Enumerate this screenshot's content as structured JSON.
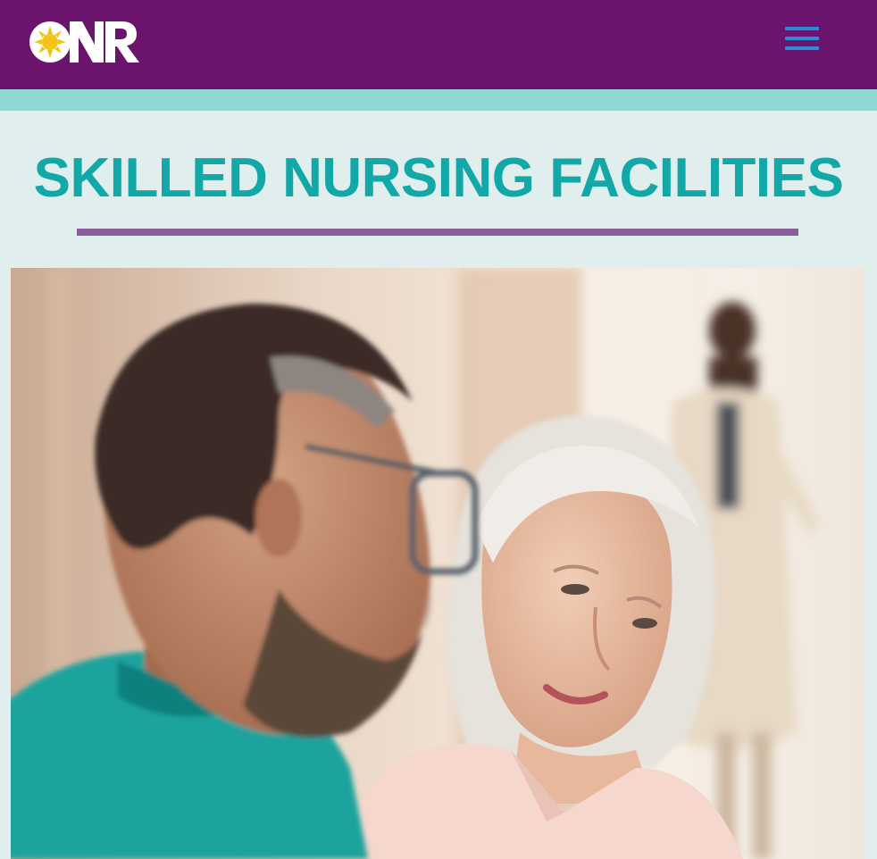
{
  "header": {
    "logo_text": "ONR",
    "menu_icon": "hamburger-menu-icon"
  },
  "page": {
    "title": "SKILLED NURSING FACILITIES"
  },
  "hero": {
    "image_subject": "nurse-with-senior-resident-photo"
  },
  "colors": {
    "header_bg": "#6b146e",
    "accent_band": "#8fd8d4",
    "page_bg": "#e0efee",
    "title": "#12a8a7",
    "title_rule": "#8a5f9e",
    "menu_icon": "#2a8bd8"
  }
}
